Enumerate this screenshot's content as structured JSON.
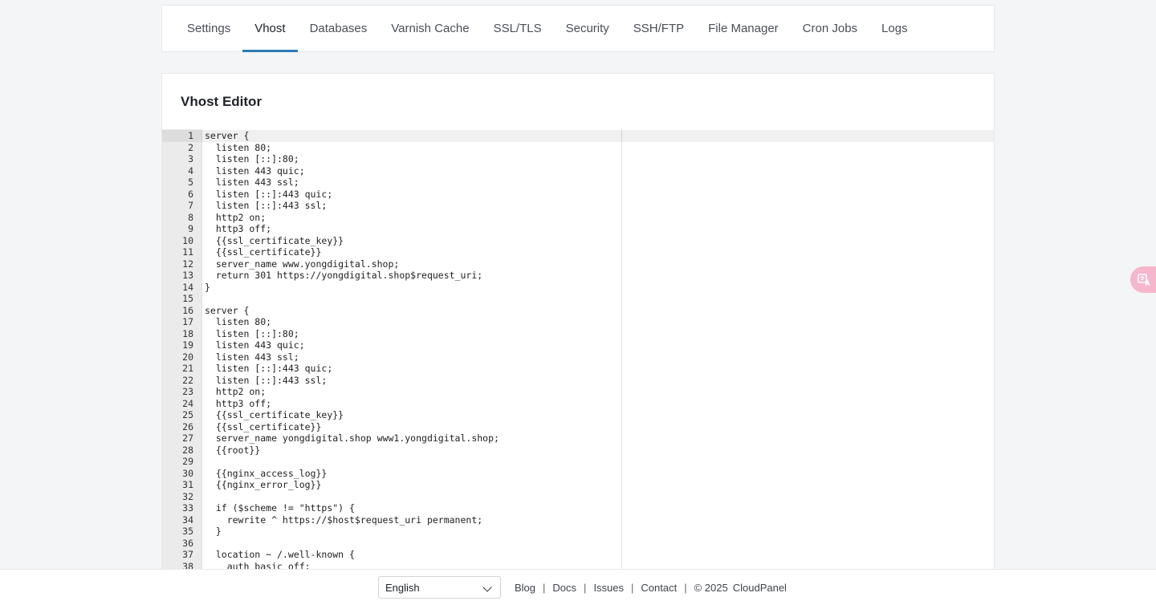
{
  "tabs": [
    {
      "label": "Settings",
      "active": false
    },
    {
      "label": "Vhost",
      "active": true
    },
    {
      "label": "Databases",
      "active": false
    },
    {
      "label": "Varnish Cache",
      "active": false
    },
    {
      "label": "SSL/TLS",
      "active": false
    },
    {
      "label": "Security",
      "active": false
    },
    {
      "label": "SSH/FTP",
      "active": false
    },
    {
      "label": "File Manager",
      "active": false
    },
    {
      "label": "Cron Jobs",
      "active": false
    },
    {
      "label": "Logs",
      "active": false
    }
  ],
  "editor": {
    "title": "Vhost Editor",
    "lines": [
      "server {",
      "  listen 80;",
      "  listen [::]:80;",
      "  listen 443 quic;",
      "  listen 443 ssl;",
      "  listen [::]:443 quic;",
      "  listen [::]:443 ssl;",
      "  http2 on;",
      "  http3 off;",
      "  {{ssl_certificate_key}}",
      "  {{ssl_certificate}}",
      "  server_name www.yongdigital.shop;",
      "  return 301 https://yongdigital.shop$request_uri;",
      "}",
      "",
      "server {",
      "  listen 80;",
      "  listen [::]:80;",
      "  listen 443 quic;",
      "  listen 443 ssl;",
      "  listen [::]:443 quic;",
      "  listen [::]:443 ssl;",
      "  http2 on;",
      "  http3 off;",
      "  {{ssl_certificate_key}}",
      "  {{ssl_certificate}}",
      "  server_name yongdigital.shop www1.yongdigital.shop;",
      "  {{root}}",
      "",
      "  {{nginx_access_log}}",
      "  {{nginx_error_log}}",
      "",
      "  if ($scheme != \"https\") {",
      "    rewrite ^ https://$host$request_uri permanent;",
      "  }",
      "",
      "  location ~ /.well-known {",
      "    auth_basic off;"
    ]
  },
  "footer": {
    "language": "English",
    "links": [
      "Blog",
      "Docs",
      "Issues",
      "Contact"
    ],
    "copyright": "© 2025",
    "brand": "CloudPanel"
  },
  "icons": {
    "translate": "translate-icon",
    "chevron": "chevron-down-icon"
  },
  "colors": {
    "accent": "#2a7ab8",
    "translate_fab": "#f6b6cc"
  }
}
